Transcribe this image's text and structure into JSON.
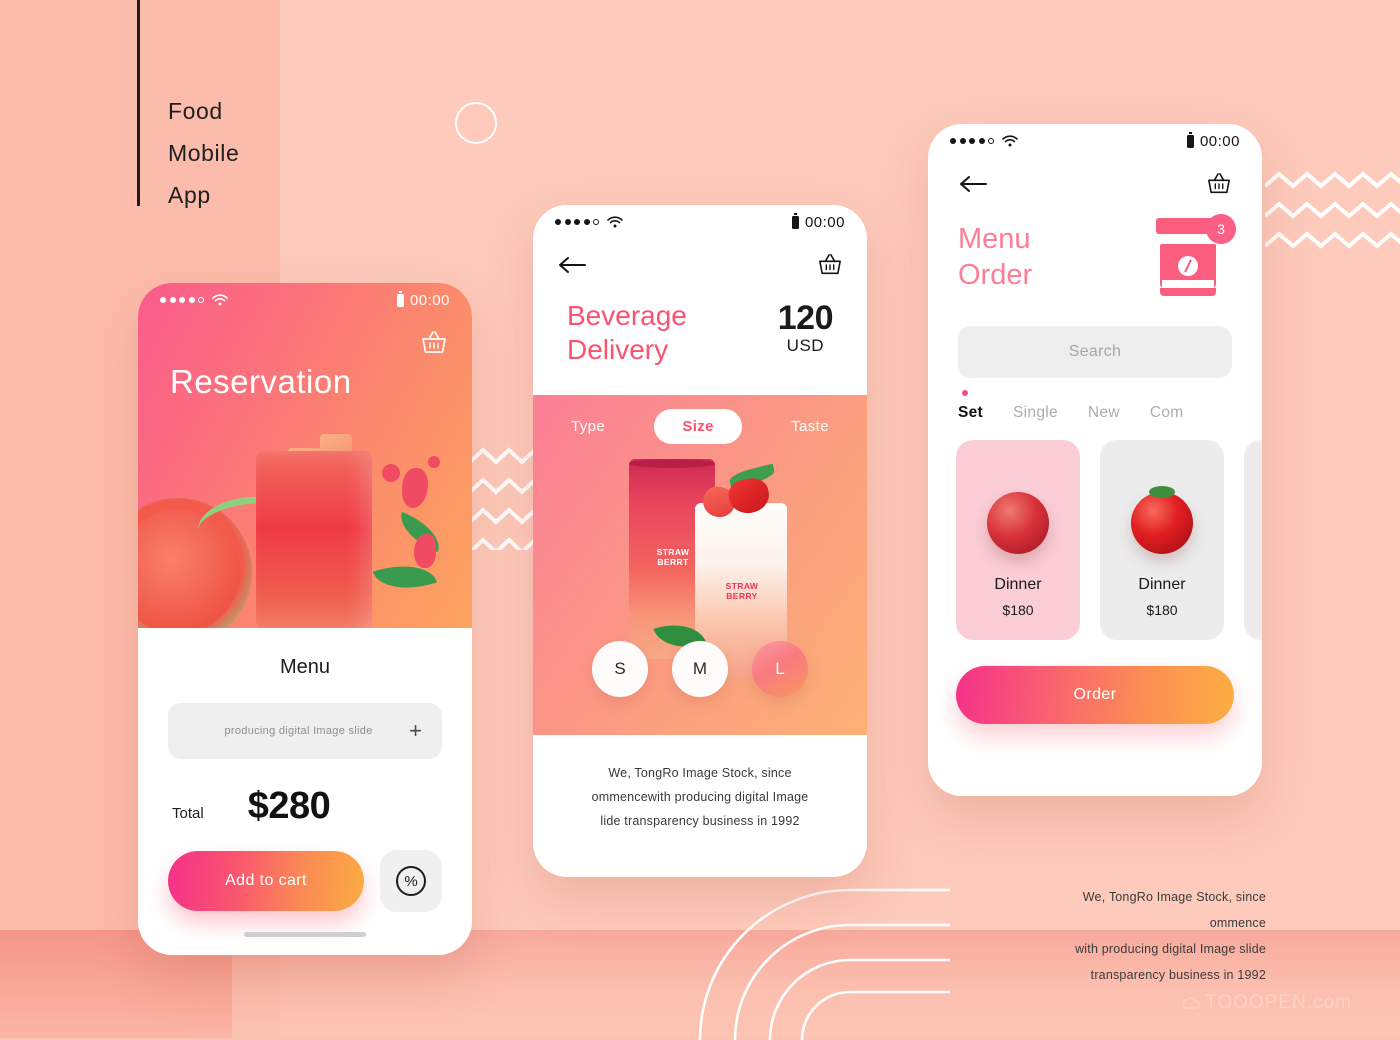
{
  "page": {
    "header_lines": [
      "Food",
      "Mobile",
      "App"
    ],
    "watermark": "TOOOPEN.com",
    "caption_lines": [
      "We, TongRo Image Stock, since ommence",
      "with producing digital Image slide",
      "transparency business in 1992"
    ],
    "colors": {
      "background_left": "#fcbcab",
      "background_right": "#fdcabb",
      "accent_pink": "#fb536f",
      "accent_orange": "#fcae42",
      "title_pink": "#fb7f96"
    }
  },
  "phone1": {
    "status": {
      "time": "00:00",
      "signal_dots": 5,
      "signal_filled": 4,
      "wifi_icon": "wifi-icon",
      "battery_icon": "battery-icon"
    },
    "cart_icon": "basket-icon",
    "hero_title": "Reservation",
    "menu_heading": "Menu",
    "item_label": "producing digital Image slide",
    "add_icon": "plus-icon",
    "total_label": "Total",
    "total_value": "$280",
    "cart_button": "Add to cart",
    "discount_icon": "percent-icon",
    "discount_glyph": "%"
  },
  "phone2": {
    "status": {
      "time": "00:00",
      "signal_dots": 5,
      "signal_filled": 4,
      "wifi_icon": "wifi-icon",
      "battery_icon": "battery-icon"
    },
    "back_icon": "back-arrow-icon",
    "cart_icon": "basket-icon",
    "title_line1": "Beverage",
    "title_line2": "Delivery",
    "price_number": "120",
    "price_currency": "USD",
    "tabs": [
      {
        "label": "Type",
        "active": false
      },
      {
        "label": "Size",
        "active": true
      },
      {
        "label": "Taste",
        "active": false
      }
    ],
    "cup_label_a": "STRAW\nBERRT",
    "cup_label_a_l1": "STRAW",
    "cup_label_a_l2": "BERRT",
    "cup_label_b_l1": "STRAW",
    "cup_label_b_l2": "BERRY",
    "sizes": [
      {
        "label": "S",
        "selected": false
      },
      {
        "label": "M",
        "selected": false
      },
      {
        "label": "L",
        "selected": true
      }
    ],
    "description_lines": [
      "We, TongRo Image Stock, since",
      "ommencewith producing digital Image",
      "lide transparency business in 1992"
    ]
  },
  "phone3": {
    "status": {
      "time": "00:00",
      "signal_dots": 5,
      "signal_filled": 4,
      "wifi_icon": "wifi-icon",
      "battery_icon": "battery-icon"
    },
    "back_icon": "back-arrow-icon",
    "cart_icon": "basket-icon",
    "title_line1": "Menu",
    "title_line2": "Order",
    "cup_icon": "coffee-cup-icon",
    "cart_badge": "3",
    "search_placeholder": "Search",
    "categories": [
      {
        "label": "Set",
        "active": true
      },
      {
        "label": "Single",
        "active": false
      },
      {
        "label": "New",
        "active": false
      },
      {
        "label": "Com",
        "active": false
      }
    ],
    "cards": [
      {
        "name": "Dinner",
        "price": "$180",
        "fruit": "apple",
        "style": "pink"
      },
      {
        "name": "Dinner",
        "price": "$180",
        "fruit": "tomato",
        "style": "grey"
      }
    ],
    "order_button": "Order"
  }
}
